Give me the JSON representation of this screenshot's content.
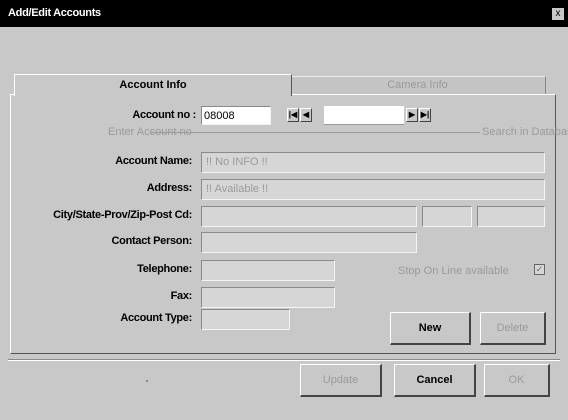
{
  "window": {
    "title": "Add/Edit Accounts",
    "close_label": "x"
  },
  "tabs": {
    "active": "Account Info",
    "inactive": "Camera Info"
  },
  "account_no": {
    "label": "Account no :",
    "value": "08008",
    "hint": "Enter Account no",
    "search_hint": "Search in Database"
  },
  "navigator": {
    "first": "|◀",
    "prev": "◀",
    "next": "▶",
    "last": "▶|"
  },
  "fields": {
    "account_name": {
      "label": "Account Name:",
      "value": "!! No INFO !!"
    },
    "address": {
      "label": "Address:",
      "value": "!! Available !!"
    },
    "city_state": {
      "label": "City/State-Prov/Zip-Post Cd:"
    },
    "contact_person": {
      "label": "Contact Person:"
    },
    "telephone": {
      "label": "Telephone:"
    },
    "fax": {
      "label": "Fax:"
    },
    "account_type": {
      "label": "Account Type:"
    }
  },
  "stop_on_line": {
    "label": "Stop On Line available",
    "checked": true
  },
  "buttons": {
    "new": "New",
    "delete": "Delete",
    "update": "Update",
    "cancel": "Cancel",
    "ok": "OK"
  }
}
